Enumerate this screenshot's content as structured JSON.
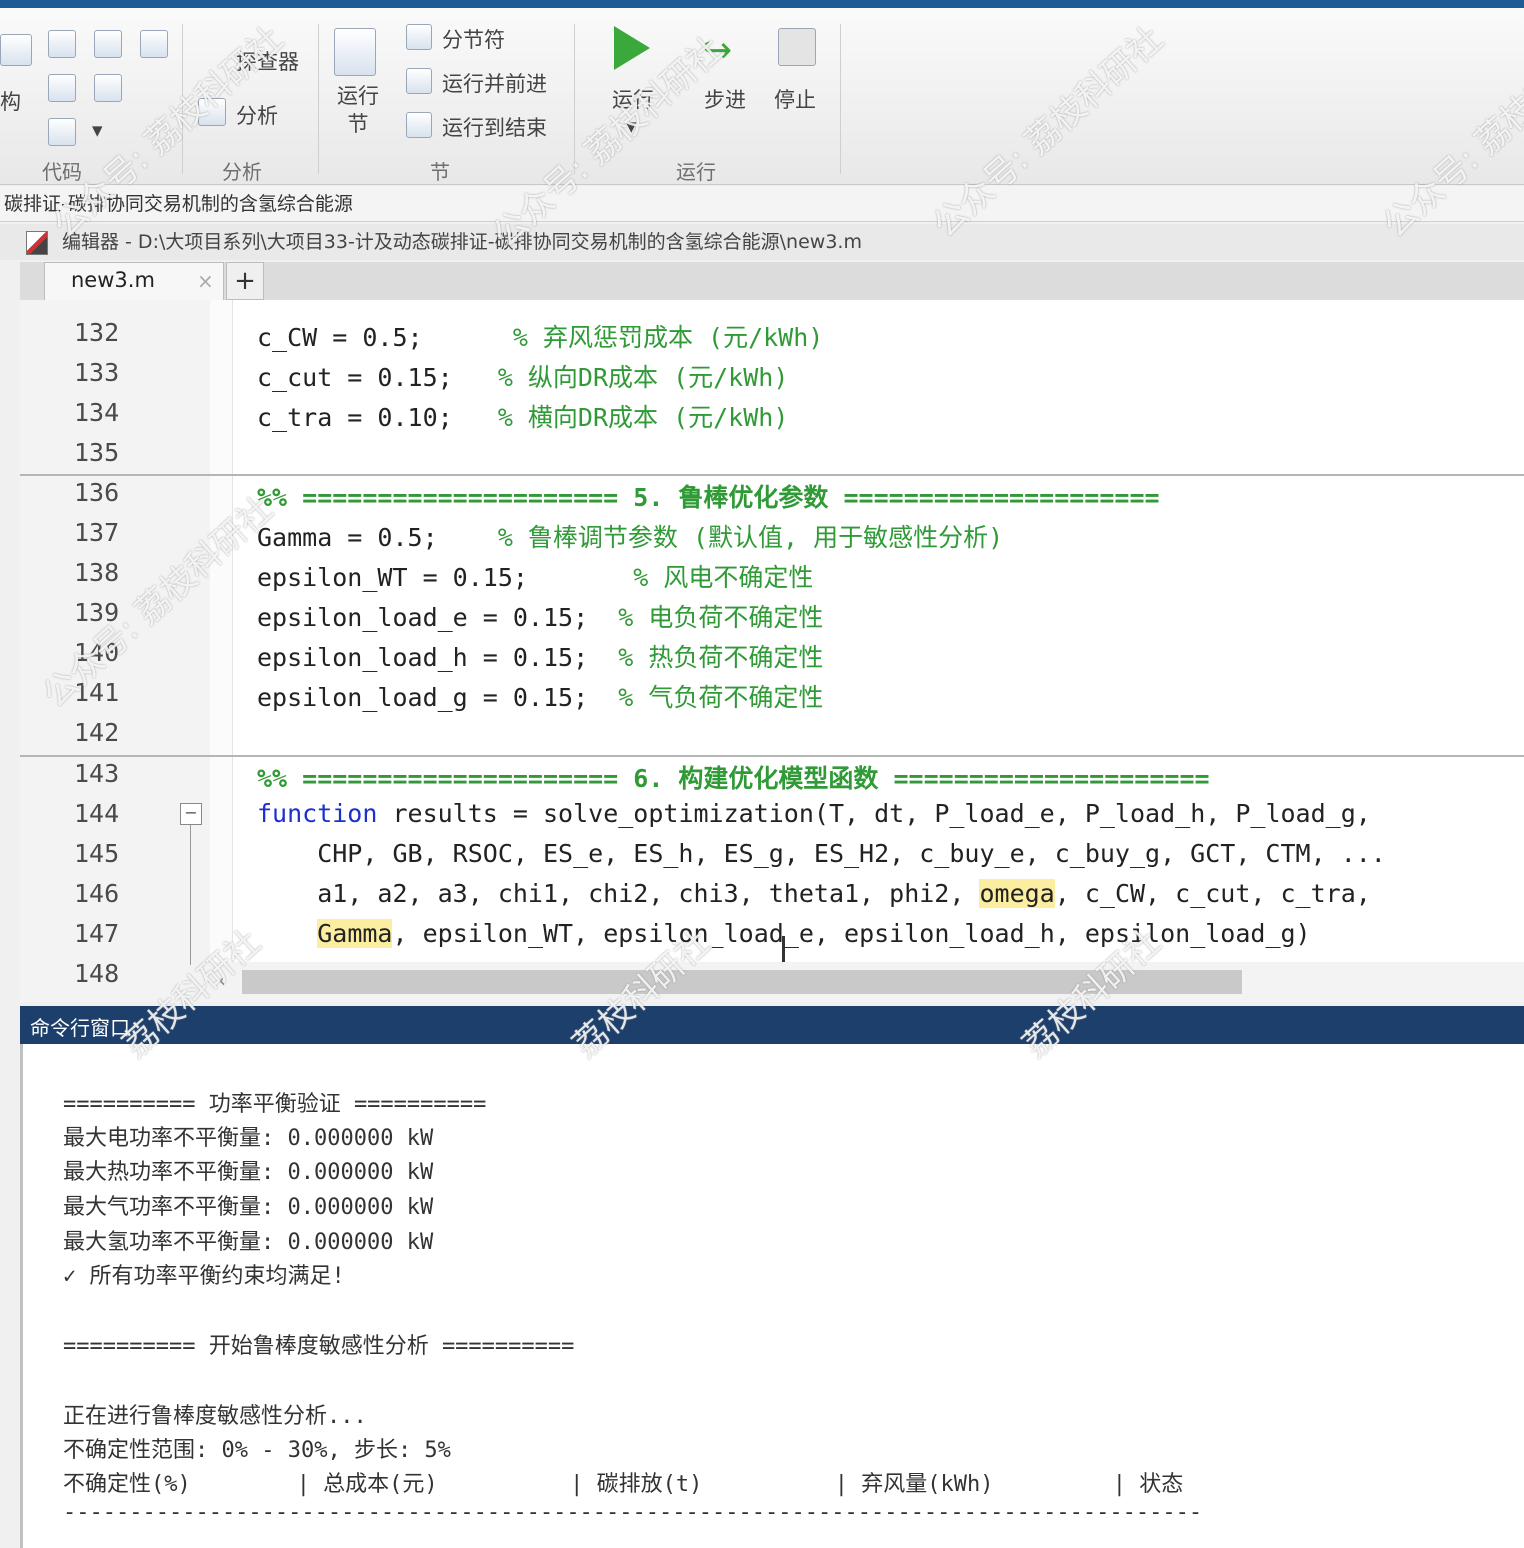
{
  "ribbon": {
    "groups": {
      "code": "代码",
      "analyze": "分析",
      "section": "节",
      "run": "运行"
    },
    "labels": {
      "struct": "构",
      "explorer": "探查器",
      "analyze": "分析",
      "run_section": "运行节",
      "section_break": "分节符",
      "run_and_advance": "运行并前进",
      "run_to_end": "运行到结束",
      "run": "运行",
      "step": "步进",
      "stop": "停止"
    }
  },
  "breadcrumb": "碳排证-碳排协同交易机制的含氢综合能源",
  "editor": {
    "title": "编辑器 - D:\\大项目系列\\大项目33-计及动态碳排证-碳排协同交易机制的含氢综合能源\\new3.m",
    "tab_label": "new3.m",
    "tab_close": "×",
    "tab_add": "+",
    "lines": [
      {
        "n": "132",
        "code": "c_CW = 0.5;      ",
        "comment": "% 弃风惩罚成本 (元/kWh)"
      },
      {
        "n": "133",
        "code": "c_cut = 0.15;   ",
        "comment": "% 纵向DR成本 (元/kWh)"
      },
      {
        "n": "134",
        "code": "c_tra = 0.10;   ",
        "comment": "% 横向DR成本 (元/kWh)"
      },
      {
        "n": "135",
        "code": "",
        "comment": ""
      },
      {
        "n": "136",
        "code": "",
        "comment": "%% ===================== 5. 鲁棒优化参数 ====================="
      },
      {
        "n": "137",
        "code": "Gamma = 0.5;    ",
        "comment": "% 鲁棒调节参数 (默认值, 用于敏感性分析)"
      },
      {
        "n": "138",
        "code": "epsilon_WT = 0.15;       ",
        "comment": "% 风电不确定性"
      },
      {
        "n": "139",
        "code": "epsilon_load_e = 0.15;  ",
        "comment": "% 电负荷不确定性"
      },
      {
        "n": "140",
        "code": "epsilon_load_h = 0.15;  ",
        "comment": "% 热负荷不确定性"
      },
      {
        "n": "141",
        "code": "epsilon_load_g = 0.15;  ",
        "comment": "% 气负荷不确定性"
      },
      {
        "n": "142",
        "code": "",
        "comment": ""
      },
      {
        "n": "143",
        "code": "",
        "comment": "%% ===================== 6. 构建优化模型函数 ====================="
      },
      {
        "n": "144",
        "kw": "function",
        "code": " results = solve_optimization(T, dt, P_load_e, P_load_h, P_load_g,"
      },
      {
        "n": "145",
        "code": "    CHP, GB, RSOC, ES_e, ES_h, ES_g, ES_H2, c_buy_e, c_buy_g, GCT, CTM, ..."
      },
      {
        "n": "146",
        "code_a": "    a1, a2, a3, chi1, chi2, chi3, theta1, phi2, ",
        "hl": "omega",
        "code_b": ", c_CW, c_cut, c_tra,"
      },
      {
        "n": "147",
        "code_a": "    ",
        "hl": "Gamma",
        "code_b": ", epsilon_WT, epsilon_load_e, epsilon_load_h, epsilon_load_g)"
      },
      {
        "n": "148",
        "code": "",
        "comment": ""
      }
    ]
  },
  "command_window": {
    "title": "命令行窗口",
    "lines": [
      "========== 功率平衡验证 ==========",
      "最大电功率不平衡量: 0.000000 kW",
      "最大热功率不平衡量: 0.000000 kW",
      "最大气功率不平衡量: 0.000000 kW",
      "最大氢功率不平衡量: 0.000000 kW",
      "✓ 所有功率平衡约束均满足!",
      "",
      "========== 开始鲁棒度敏感性分析 ==========",
      "",
      "正在进行鲁棒度敏感性分析...",
      "不确定性范围: 0% - 30%, 步长: 5%",
      "不确定性(%)        | 总成本(元)          | 碳排放(t)          | 弃风量(kWh)         | 状态",
      "--------------------------------------------------------------------------------------"
    ]
  },
  "watermark": "公众号: 荔枝科研社",
  "watermark_short": "荔枝科研社"
}
